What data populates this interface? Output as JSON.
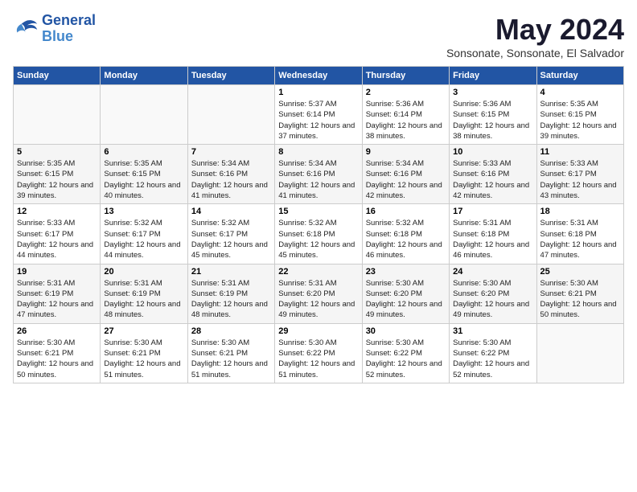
{
  "logo": {
    "line1": "General",
    "line2": "Blue"
  },
  "title": "May 2024",
  "location": "Sonsonate, Sonsonate, El Salvador",
  "weekdays": [
    "Sunday",
    "Monday",
    "Tuesday",
    "Wednesday",
    "Thursday",
    "Friday",
    "Saturday"
  ],
  "weeks": [
    [
      {
        "day": "",
        "sunrise": "",
        "sunset": "",
        "daylight": ""
      },
      {
        "day": "",
        "sunrise": "",
        "sunset": "",
        "daylight": ""
      },
      {
        "day": "",
        "sunrise": "",
        "sunset": "",
        "daylight": ""
      },
      {
        "day": "1",
        "sunrise": "Sunrise: 5:37 AM",
        "sunset": "Sunset: 6:14 PM",
        "daylight": "Daylight: 12 hours and 37 minutes."
      },
      {
        "day": "2",
        "sunrise": "Sunrise: 5:36 AM",
        "sunset": "Sunset: 6:14 PM",
        "daylight": "Daylight: 12 hours and 38 minutes."
      },
      {
        "day": "3",
        "sunrise": "Sunrise: 5:36 AM",
        "sunset": "Sunset: 6:15 PM",
        "daylight": "Daylight: 12 hours and 38 minutes."
      },
      {
        "day": "4",
        "sunrise": "Sunrise: 5:35 AM",
        "sunset": "Sunset: 6:15 PM",
        "daylight": "Daylight: 12 hours and 39 minutes."
      }
    ],
    [
      {
        "day": "5",
        "sunrise": "Sunrise: 5:35 AM",
        "sunset": "Sunset: 6:15 PM",
        "daylight": "Daylight: 12 hours and 39 minutes."
      },
      {
        "day": "6",
        "sunrise": "Sunrise: 5:35 AM",
        "sunset": "Sunset: 6:15 PM",
        "daylight": "Daylight: 12 hours and 40 minutes."
      },
      {
        "day": "7",
        "sunrise": "Sunrise: 5:34 AM",
        "sunset": "Sunset: 6:16 PM",
        "daylight": "Daylight: 12 hours and 41 minutes."
      },
      {
        "day": "8",
        "sunrise": "Sunrise: 5:34 AM",
        "sunset": "Sunset: 6:16 PM",
        "daylight": "Daylight: 12 hours and 41 minutes."
      },
      {
        "day": "9",
        "sunrise": "Sunrise: 5:34 AM",
        "sunset": "Sunset: 6:16 PM",
        "daylight": "Daylight: 12 hours and 42 minutes."
      },
      {
        "day": "10",
        "sunrise": "Sunrise: 5:33 AM",
        "sunset": "Sunset: 6:16 PM",
        "daylight": "Daylight: 12 hours and 42 minutes."
      },
      {
        "day": "11",
        "sunrise": "Sunrise: 5:33 AM",
        "sunset": "Sunset: 6:17 PM",
        "daylight": "Daylight: 12 hours and 43 minutes."
      }
    ],
    [
      {
        "day": "12",
        "sunrise": "Sunrise: 5:33 AM",
        "sunset": "Sunset: 6:17 PM",
        "daylight": "Daylight: 12 hours and 44 minutes."
      },
      {
        "day": "13",
        "sunrise": "Sunrise: 5:32 AM",
        "sunset": "Sunset: 6:17 PM",
        "daylight": "Daylight: 12 hours and 44 minutes."
      },
      {
        "day": "14",
        "sunrise": "Sunrise: 5:32 AM",
        "sunset": "Sunset: 6:17 PM",
        "daylight": "Daylight: 12 hours and 45 minutes."
      },
      {
        "day": "15",
        "sunrise": "Sunrise: 5:32 AM",
        "sunset": "Sunset: 6:18 PM",
        "daylight": "Daylight: 12 hours and 45 minutes."
      },
      {
        "day": "16",
        "sunrise": "Sunrise: 5:32 AM",
        "sunset": "Sunset: 6:18 PM",
        "daylight": "Daylight: 12 hours and 46 minutes."
      },
      {
        "day": "17",
        "sunrise": "Sunrise: 5:31 AM",
        "sunset": "Sunset: 6:18 PM",
        "daylight": "Daylight: 12 hours and 46 minutes."
      },
      {
        "day": "18",
        "sunrise": "Sunrise: 5:31 AM",
        "sunset": "Sunset: 6:18 PM",
        "daylight": "Daylight: 12 hours and 47 minutes."
      }
    ],
    [
      {
        "day": "19",
        "sunrise": "Sunrise: 5:31 AM",
        "sunset": "Sunset: 6:19 PM",
        "daylight": "Daylight: 12 hours and 47 minutes."
      },
      {
        "day": "20",
        "sunrise": "Sunrise: 5:31 AM",
        "sunset": "Sunset: 6:19 PM",
        "daylight": "Daylight: 12 hours and 48 minutes."
      },
      {
        "day": "21",
        "sunrise": "Sunrise: 5:31 AM",
        "sunset": "Sunset: 6:19 PM",
        "daylight": "Daylight: 12 hours and 48 minutes."
      },
      {
        "day": "22",
        "sunrise": "Sunrise: 5:31 AM",
        "sunset": "Sunset: 6:20 PM",
        "daylight": "Daylight: 12 hours and 49 minutes."
      },
      {
        "day": "23",
        "sunrise": "Sunrise: 5:30 AM",
        "sunset": "Sunset: 6:20 PM",
        "daylight": "Daylight: 12 hours and 49 minutes."
      },
      {
        "day": "24",
        "sunrise": "Sunrise: 5:30 AM",
        "sunset": "Sunset: 6:20 PM",
        "daylight": "Daylight: 12 hours and 49 minutes."
      },
      {
        "day": "25",
        "sunrise": "Sunrise: 5:30 AM",
        "sunset": "Sunset: 6:21 PM",
        "daylight": "Daylight: 12 hours and 50 minutes."
      }
    ],
    [
      {
        "day": "26",
        "sunrise": "Sunrise: 5:30 AM",
        "sunset": "Sunset: 6:21 PM",
        "daylight": "Daylight: 12 hours and 50 minutes."
      },
      {
        "day": "27",
        "sunrise": "Sunrise: 5:30 AM",
        "sunset": "Sunset: 6:21 PM",
        "daylight": "Daylight: 12 hours and 51 minutes."
      },
      {
        "day": "28",
        "sunrise": "Sunrise: 5:30 AM",
        "sunset": "Sunset: 6:21 PM",
        "daylight": "Daylight: 12 hours and 51 minutes."
      },
      {
        "day": "29",
        "sunrise": "Sunrise: 5:30 AM",
        "sunset": "Sunset: 6:22 PM",
        "daylight": "Daylight: 12 hours and 51 minutes."
      },
      {
        "day": "30",
        "sunrise": "Sunrise: 5:30 AM",
        "sunset": "Sunset: 6:22 PM",
        "daylight": "Daylight: 12 hours and 52 minutes."
      },
      {
        "day": "31",
        "sunrise": "Sunrise: 5:30 AM",
        "sunset": "Sunset: 6:22 PM",
        "daylight": "Daylight: 12 hours and 52 minutes."
      },
      {
        "day": "",
        "sunrise": "",
        "sunset": "",
        "daylight": ""
      }
    ]
  ]
}
